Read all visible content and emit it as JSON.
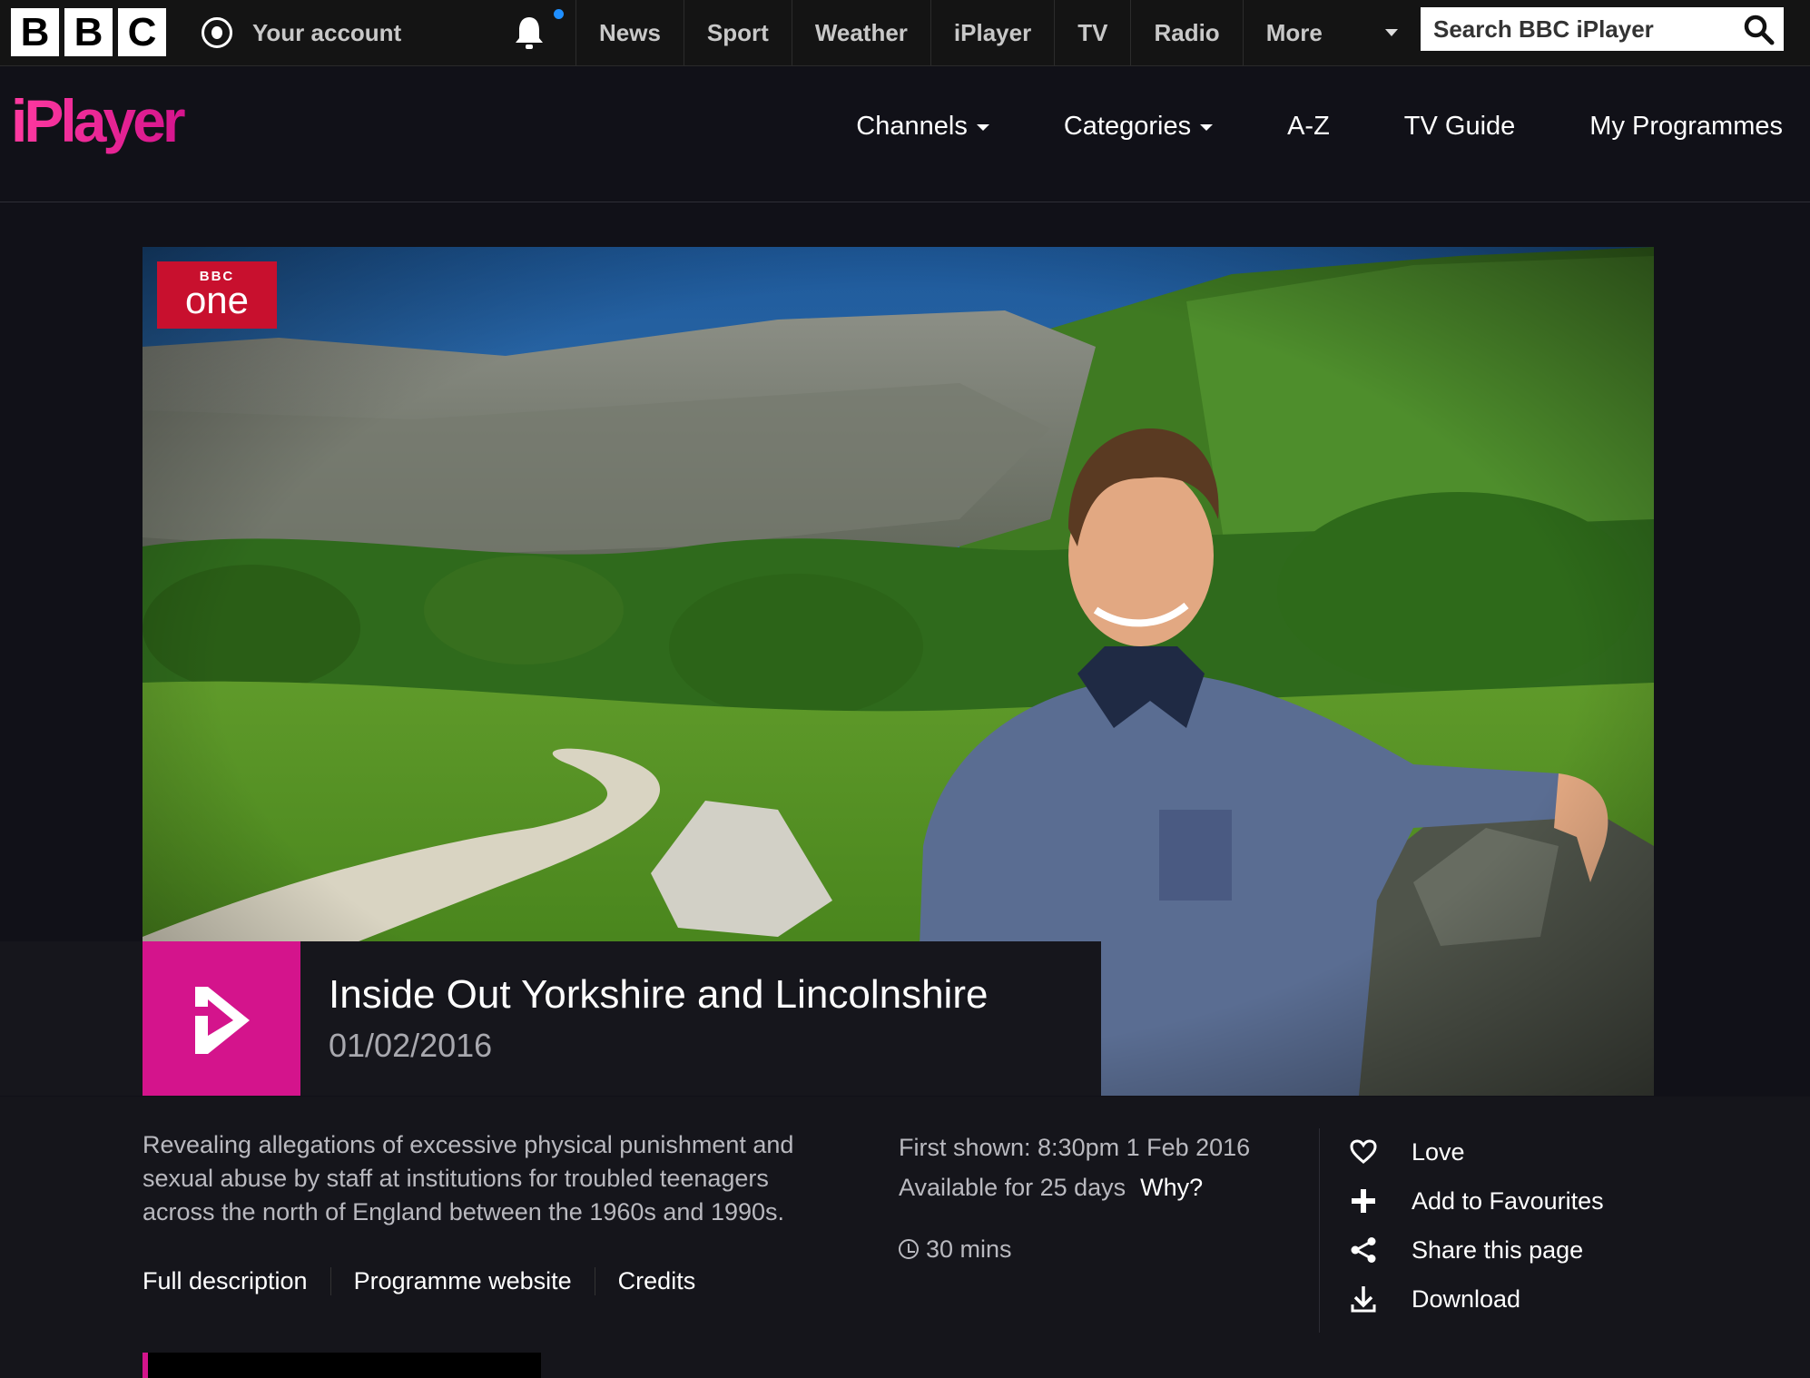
{
  "bbc_header": {
    "logo_letters": [
      "B",
      "B",
      "C"
    ],
    "account_label": "Your account",
    "nav": [
      "News",
      "Sport",
      "Weather",
      "iPlayer",
      "TV",
      "Radio",
      "More"
    ],
    "search_placeholder": "Search BBC iPlayer"
  },
  "iplayer": {
    "logo_text": "iPlayer",
    "nav": {
      "channels": "Channels",
      "categories": "Categories",
      "az": "A-Z",
      "tv_guide": "TV Guide",
      "my_programmes": "My Programmes"
    }
  },
  "hero": {
    "channel_badge_top": "BBC",
    "channel_badge_name": "one",
    "title": "Inside Out Yorkshire and Lincolnshire",
    "date": "01/02/2016"
  },
  "programme": {
    "description": "Revealing allegations of excessive physical punishment and sexual abuse by staff at institutions for troubled teenagers across the north of England between the 1960s and 1990s.",
    "links": [
      "Full description",
      "Programme website",
      "Credits"
    ],
    "first_shown": "First shown: 8:30pm 1 Feb 2016",
    "availability": "Available for 25 days",
    "why": "Why?",
    "duration": "30 mins"
  },
  "actions": {
    "love": "Love",
    "favourites": "Add to Favourites",
    "share": "Share this page",
    "download": "Download"
  },
  "colors": {
    "iplayer_pink": "#d4148c",
    "bbc_one_red": "#c8102e",
    "background": "#111118",
    "notification_dot": "#1f8fff"
  }
}
